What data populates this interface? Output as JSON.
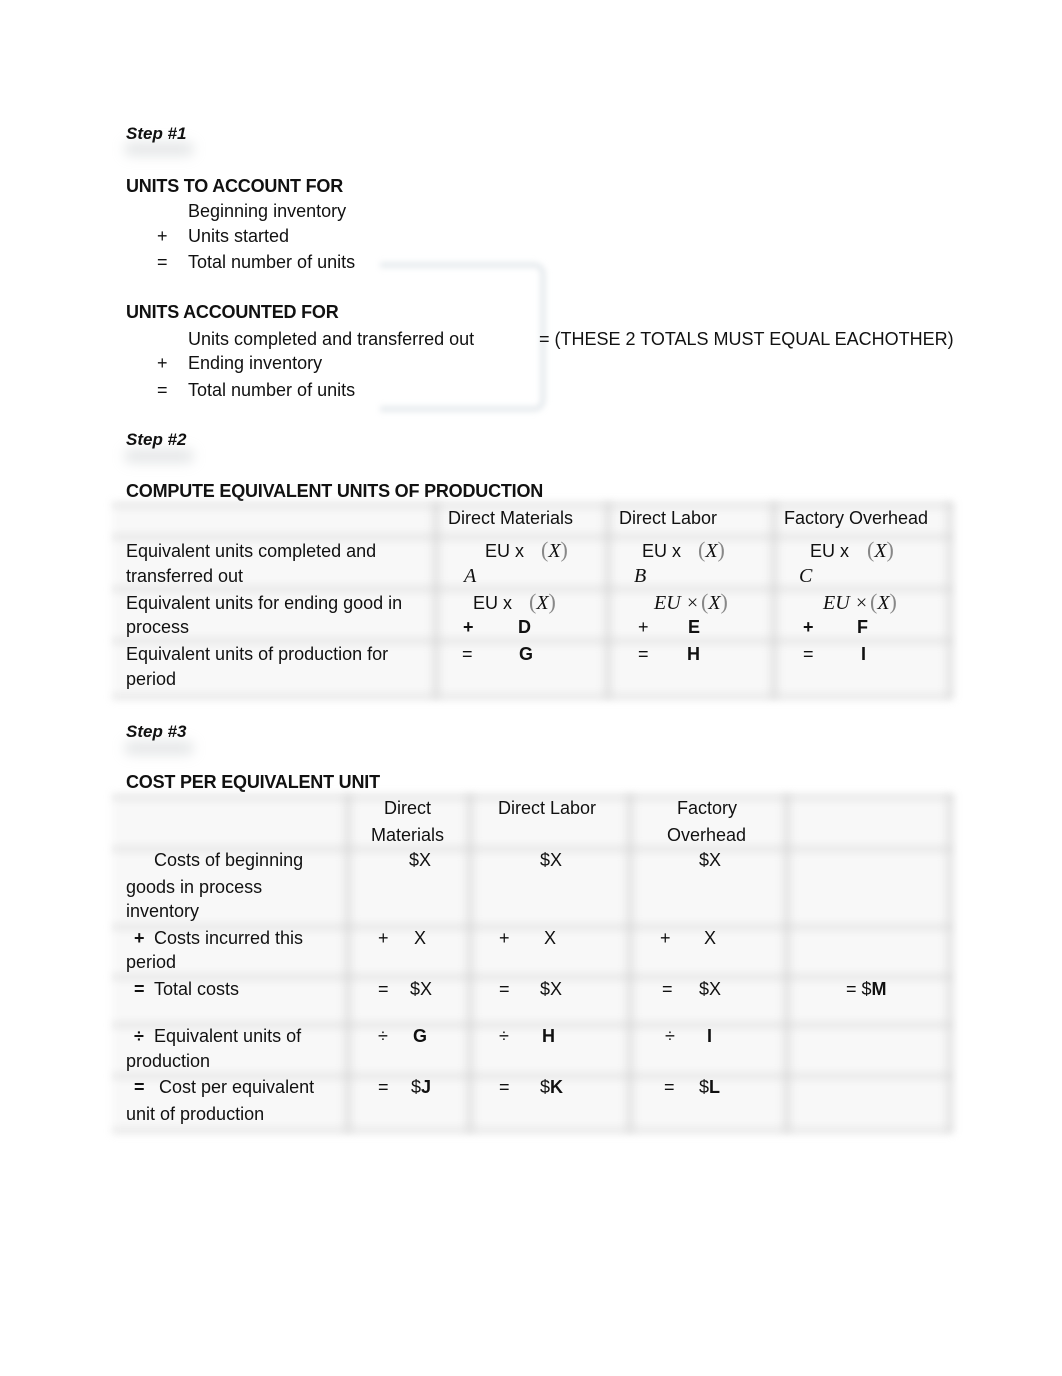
{
  "step1": {
    "label": "Step #1",
    "to_account": {
      "heading": "UNITS TO ACCOUNT FOR",
      "lines": [
        {
          "op": "",
          "text": "Beginning inventory"
        },
        {
          "op": "+",
          "text": "Units started"
        },
        {
          "op": "=",
          "text": "Total number of units"
        }
      ]
    },
    "accounted": {
      "heading": "UNITS ACCOUNTED FOR",
      "lines": [
        {
          "op": "",
          "text": "Units completed and transferred out"
        },
        {
          "op": "+",
          "text": "Ending inventory"
        },
        {
          "op": "=",
          "text": "Total number of units"
        }
      ]
    },
    "note": "= (THESE 2 TOTALS MUST EQUAL EACHOTHER)"
  },
  "step2": {
    "label": "Step #2",
    "heading": "COMPUTE EQUIVALENT UNITS OF PRODUCTION",
    "columns": [
      "Direct Materials",
      "Direct Labor",
      "Factory Overhead"
    ],
    "rows": [
      {
        "label_line1": "Equivalent units completed and",
        "label_line2": "transferred out",
        "cells": [
          {
            "formula": "EU x",
            "paren": "X",
            "var": "A"
          },
          {
            "formula": "EU x",
            "paren": "X",
            "var": "B"
          },
          {
            "formula": "EU x",
            "paren": "X",
            "var": "C"
          }
        ]
      },
      {
        "label_line1": "Equivalent units for ending good in",
        "label_line2": "process",
        "cells": [
          {
            "formula": "EU x",
            "paren": "X",
            "op": "+",
            "var": "D"
          },
          {
            "formula": "EU ×",
            "paren": "X",
            "op": "+",
            "var": "E"
          },
          {
            "formula": "EU ×",
            "paren": "X",
            "op": "+",
            "var": "F"
          }
        ]
      },
      {
        "label_line1": "Equivalent units of production for",
        "label_line2": "period",
        "cells": [
          {
            "op": "=",
            "var": "G"
          },
          {
            "op": "=",
            "var": "H"
          },
          {
            "op": "=",
            "var": "I"
          }
        ]
      }
    ]
  },
  "step3": {
    "label": "Step #3",
    "heading": "COST PER EQUIVALENT UNIT",
    "columns": [
      {
        "line1": "Direct",
        "line2": "Materials"
      },
      {
        "line1": "Direct Labor",
        "line2": ""
      },
      {
        "line1": "Factory",
        "line2": "Overhead"
      }
    ],
    "rows": [
      {
        "label": [
          "Costs of beginning",
          "goods in process",
          "inventory"
        ],
        "op_label": "",
        "cells": [
          {
            "op": "",
            "val": "$X"
          },
          {
            "op": "",
            "val": "$X"
          },
          {
            "op": "",
            "val": "$X"
          }
        ],
        "total": ""
      },
      {
        "label": [
          "Costs incurred this",
          "period"
        ],
        "op_label": "+",
        "cells": [
          {
            "op": "+",
            "val": "X"
          },
          {
            "op": "+",
            "val": "X"
          },
          {
            "op": "+",
            "val": "X"
          }
        ],
        "total": ""
      },
      {
        "label": [
          "Total costs"
        ],
        "op_label": "=",
        "cells": [
          {
            "op": "=",
            "val": "$X"
          },
          {
            "op": "=",
            "val": "$X"
          },
          {
            "op": "=",
            "val": "$X"
          }
        ],
        "total_prefix": "= $",
        "total": "M"
      },
      {
        "label": [
          "Equivalent units of",
          "production"
        ],
        "op_label": "÷",
        "cells": [
          {
            "op": "÷",
            "val": "G"
          },
          {
            "op": "÷",
            "val": "H"
          },
          {
            "op": "÷",
            "val": "I"
          }
        ],
        "total": ""
      },
      {
        "label": [
          "Cost per equivalent",
          "unit of production"
        ],
        "op_label": "=",
        "cells": [
          {
            "op": "=",
            "prefix": "$",
            "val": "J"
          },
          {
            "op": "=",
            "prefix": "$",
            "val": "K"
          },
          {
            "op": "=",
            "prefix": "$",
            "val": "L"
          }
        ],
        "total": ""
      }
    ]
  }
}
